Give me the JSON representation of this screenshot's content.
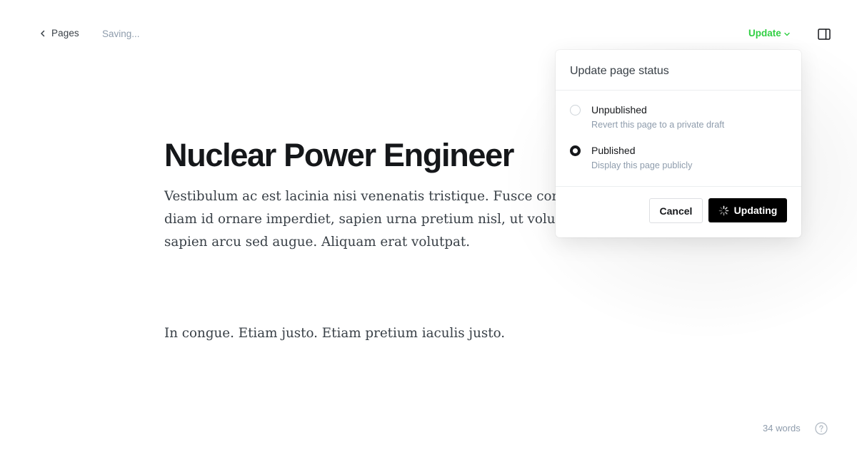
{
  "topbar": {
    "back_label": "Pages",
    "status": "Saving...",
    "update_label": "Update"
  },
  "post": {
    "title": "Nuclear Power Engineer",
    "paragraphs": [
      "Vestibulum ac est lacinia nisi venenatis tristique. Fusce congue, diam id ornare imperdiet, sapien urna pretium nisl, ut volutpat sapien arcu sed augue. Aliquam erat volutpat.",
      "In congue. Etiam justo. Etiam pretium iaculis justo."
    ]
  },
  "popover": {
    "title": "Update page status",
    "options": [
      {
        "label": "Unpublished",
        "description": "Revert this page to a private draft",
        "selected": false
      },
      {
        "label": "Published",
        "description": "Display this page publicly",
        "selected": true
      }
    ],
    "cancel_label": "Cancel",
    "confirm_label": "Updating"
  },
  "footer": {
    "word_count": "34 words"
  },
  "colors": {
    "accent_green": "#30cf43",
    "primary_button": "#000000"
  },
  "icons": [
    "chevron-left-icon",
    "chevron-down-icon",
    "sidebar-toggle-icon",
    "spinner-icon",
    "help-icon"
  ]
}
